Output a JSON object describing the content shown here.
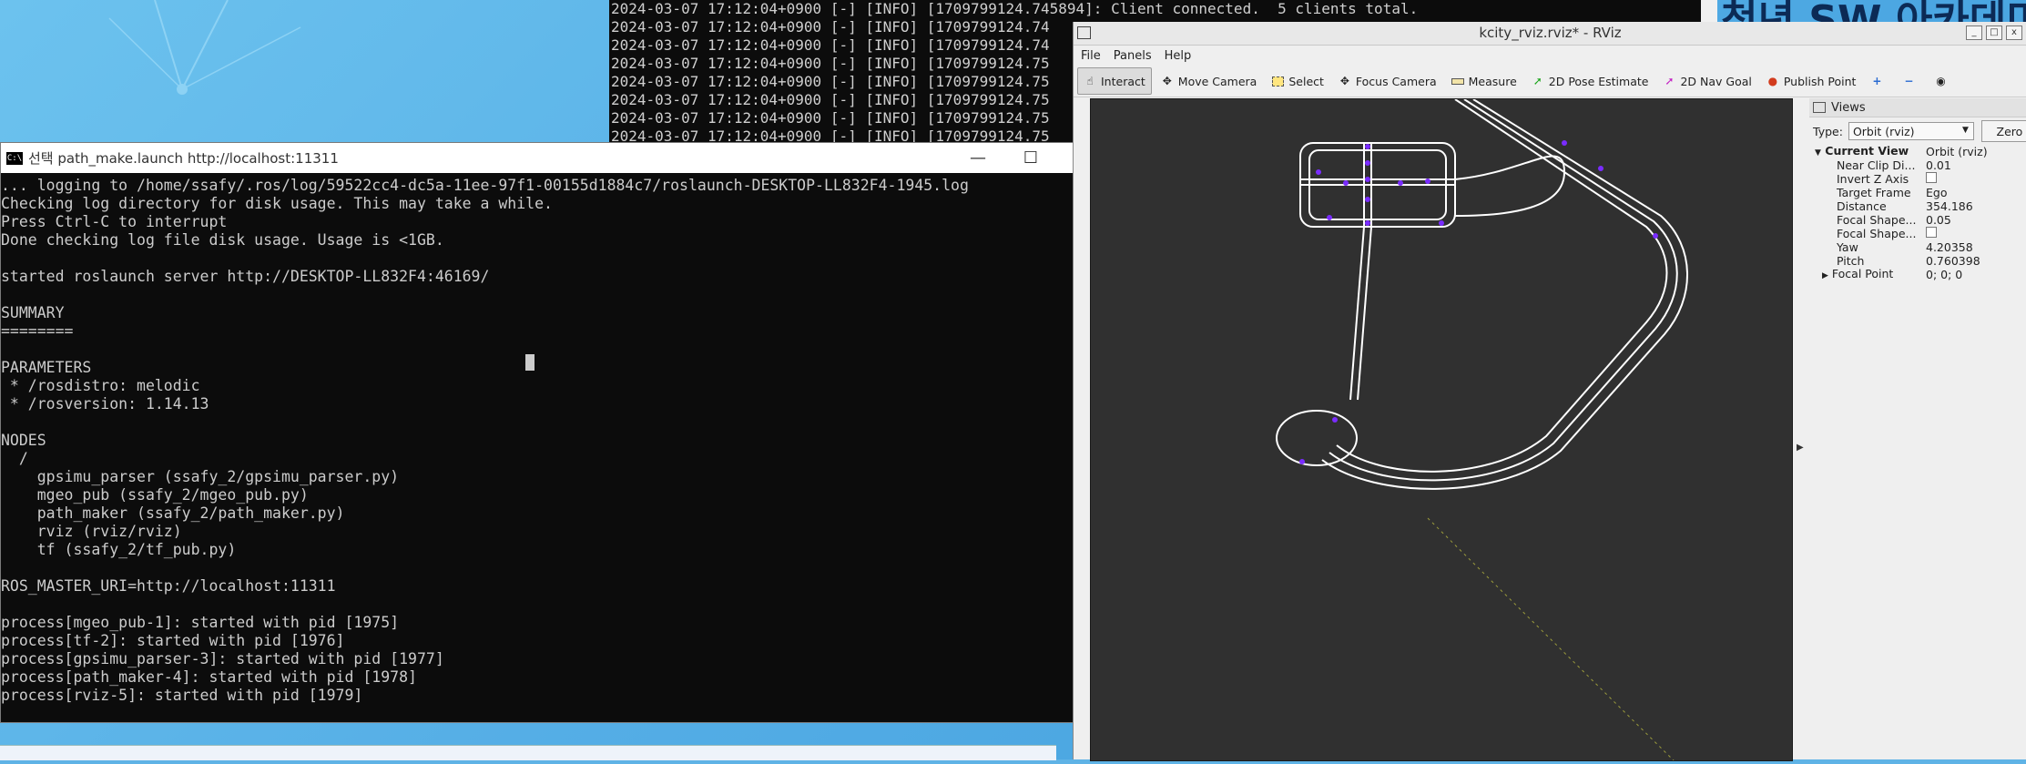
{
  "background_terminal": {
    "lines": [
      "2024-03-07 17:12:04+0900 [-] [INFO] [1709799124.745894]: Client connected.  5 clients total.",
      "2024-03-07 17:12:04+0900 [-] [INFO] [1709799124.74",
      "2024-03-07 17:12:04+0900 [-] [INFO] [1709799124.74",
      "2024-03-07 17:12:04+0900 [-] [INFO] [1709799124.75",
      "2024-03-07 17:12:04+0900 [-] [INFO] [1709799124.75",
      "2024-03-07 17:12:04+0900 [-] [INFO] [1709799124.75",
      "2024-03-07 17:12:04+0900 [-] [INFO] [1709799124.75",
      "2024-03-07 17:12:04+0900 [-] [INFO] [1709799124.75"
    ]
  },
  "banner": {
    "text": "청년 SW 아카데미"
  },
  "cmd": {
    "icon_text": "C:\\",
    "title": "선택 path_make.launch http://localhost:11311",
    "lines": [
      "... logging to /home/ssafy/.ros/log/59522cc4-dc5a-11ee-97f1-00155d1884c7/roslaunch-DESKTOP-LL832F4-1945.log",
      "Checking log directory for disk usage. This may take a while.",
      "Press Ctrl-C to interrupt",
      "Done checking log file disk usage. Usage is <1GB.",
      "",
      "started roslaunch server http://DESKTOP-LL832F4:46169/",
      "",
      "SUMMARY",
      "========",
      "",
      "PARAMETERS",
      " * /rosdistro: melodic",
      " * /rosversion: 1.14.13",
      "",
      "NODES",
      "  /",
      "    gpsimu_parser (ssafy_2/gpsimu_parser.py)",
      "    mgeo_pub (ssafy_2/mgeo_pub.py)",
      "    path_maker (ssafy_2/path_maker.py)",
      "    rviz (rviz/rviz)",
      "    tf (ssafy_2/tf_pub.py)",
      "",
      "ROS_MASTER_URI=http://localhost:11311",
      "",
      "process[mgeo_pub-1]: started with pid [1975]",
      "process[tf-2]: started with pid [1976]",
      "process[gpsimu_parser-3]: started with pid [1977]",
      "process[path_maker-4]: started with pid [1978]",
      "process[rviz-5]: started with pid [1979]"
    ]
  },
  "rviz": {
    "title": "kcity_rviz.rviz* - RViz",
    "menu": {
      "file": "File",
      "panels": "Panels",
      "help": "Help"
    },
    "tools": {
      "interact": "Interact",
      "move_camera": "Move Camera",
      "select": "Select",
      "focus_camera": "Focus Camera",
      "measure": "Measure",
      "pose_estimate": "2D Pose Estimate",
      "nav_goal": "2D Nav Goal",
      "publish_point": "Publish Point"
    },
    "views": {
      "header": "Views",
      "type_label": "Type:",
      "type_value": "Orbit (rviz)",
      "zero_label": "Zero",
      "current_view": {
        "label": "Current View",
        "value": "Orbit (rviz)"
      },
      "near_clip": {
        "label": "Near Clip Di...",
        "value": "0.01"
      },
      "invert_z": {
        "label": "Invert Z Axis"
      },
      "target_frame": {
        "label": "Target Frame",
        "value": "Ego"
      },
      "distance": {
        "label": "Distance",
        "value": "354.186"
      },
      "focal_shape_size": {
        "label": "Focal Shape...",
        "value": "0.05"
      },
      "focal_shape_fixed": {
        "label": "Focal Shape..."
      },
      "yaw": {
        "label": "Yaw",
        "value": "4.20358"
      },
      "pitch": {
        "label": "Pitch",
        "value": "0.760398"
      },
      "focal_point": {
        "label": "Focal Point",
        "value": "0; 0; 0"
      }
    }
  },
  "colors": {
    "terminal_bg": "#0c0c0c",
    "terminal_text": "#cccccc",
    "rviz_viewport": "#303030",
    "path_white": "#ffffff",
    "path_marker": "#7a2cff"
  }
}
